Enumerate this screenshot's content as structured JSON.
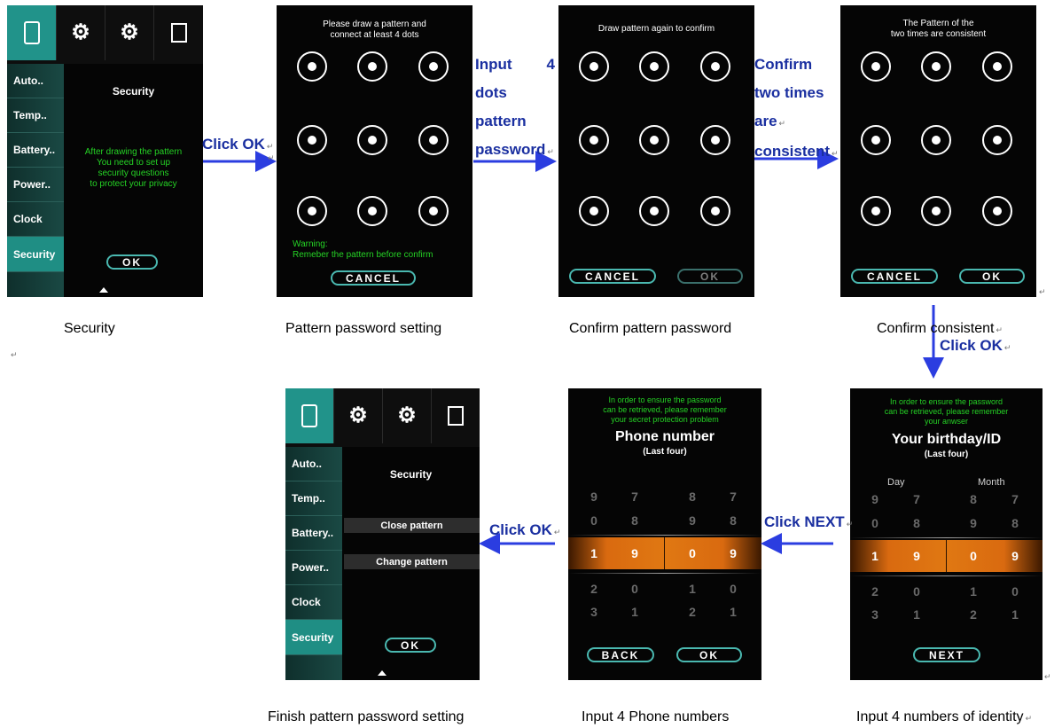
{
  "settings_screen": {
    "side_items": [
      "Auto..",
      "Temp..",
      "Battery..",
      "Power..",
      "Clock",
      "Security"
    ],
    "panel_title": "Security",
    "message_lines": [
      "After drawing the pattern",
      "You need to set up",
      "security questions",
      "to protect your privacy"
    ],
    "ok_label": "OK"
  },
  "pattern_set_screen": {
    "title_lines": [
      "Please draw a pattern and",
      "connect at least 4 dots"
    ],
    "warning_lines": [
      "Warning:",
      "Remeber the pattern before confirm"
    ],
    "cancel_label": "CANCEL"
  },
  "pattern_confirm_screen": {
    "title": "Draw pattern again to confirm",
    "cancel_label": "CANCEL",
    "ok_label": "OK"
  },
  "pattern_consistent_screen": {
    "title_lines": [
      "The Pattern of the",
      "two times are consistent"
    ],
    "cancel_label": "CANCEL",
    "ok_label": "OK"
  },
  "phone_screen": {
    "info_lines": [
      "In order to ensure the password",
      "can be retrieved, please remember",
      "your secret protection problem"
    ],
    "heading": "Phone number",
    "subheading": "(Last four)",
    "rows": [
      [
        "9",
        "7",
        "8",
        "7"
      ],
      [
        "0",
        "8",
        "9",
        "8"
      ],
      [
        "1",
        "9",
        "0",
        "9"
      ],
      [
        "2",
        "0",
        "1",
        "0"
      ],
      [
        "3",
        "1",
        "2",
        "1"
      ]
    ],
    "back_label": "BACK",
    "ok_label": "OK"
  },
  "identity_screen": {
    "info_lines": [
      "In order to ensure the password",
      "can be retrieved, please remember",
      "your anwser"
    ],
    "heading": "Your birthday/ID",
    "subheading": "(Last four)",
    "day_label": "Day",
    "month_label": "Month",
    "rows": [
      [
        "9",
        "7",
        "8",
        "7"
      ],
      [
        "0",
        "8",
        "9",
        "8"
      ],
      [
        "1",
        "9",
        "0",
        "9"
      ],
      [
        "2",
        "0",
        "1",
        "0"
      ],
      [
        "3",
        "1",
        "2",
        "1"
      ]
    ],
    "next_label": "NEXT"
  },
  "finish_screen": {
    "side_items": [
      "Auto..",
      "Temp..",
      "Battery..",
      "Power..",
      "Clock",
      "Security"
    ],
    "panel_title": "Security",
    "menu_items": [
      "Close pattern",
      "Change pattern"
    ],
    "ok_label": "OK"
  },
  "captions": {
    "security": "Security",
    "pattern_setting": "Pattern password setting",
    "confirm_pattern": "Confirm pattern password",
    "confirm_consistent": "Confirm consistent",
    "finish": "Finish pattern password setting",
    "phone": "Input 4 Phone numbers",
    "identity": "Input 4 numbers of identity"
  },
  "arrow_labels": {
    "a1": "Click OK",
    "a2_lines": [
      "Input",
      "4",
      "dots",
      "pattern",
      "password"
    ],
    "a3_lines": [
      "Confirm",
      "two times",
      "are",
      "consistent"
    ],
    "a4": "Click OK",
    "a5": "Click NEXT",
    "a6": "Click OK"
  },
  "colors": {
    "teal": "#21938a",
    "green_text": "#25d325",
    "arrow_blue": "#2b3de0",
    "label_blue": "#1a2fa0",
    "orange": "#e07812"
  }
}
